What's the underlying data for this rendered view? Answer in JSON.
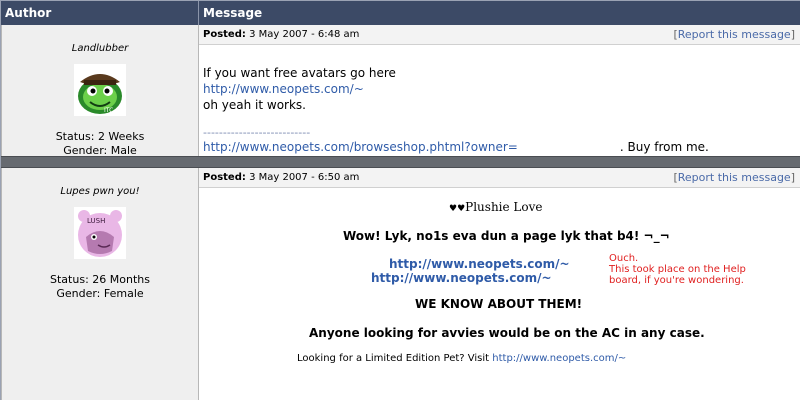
{
  "header": {
    "author_label": "Author",
    "message_label": "Message"
  },
  "posts": [
    {
      "author": "Landlubber",
      "avatar_icon": "pirate-frog-avatar-icon",
      "status": "Status: 2 Weeks",
      "gender": "Gender: Male",
      "posted_label": "Posted:",
      "posted_date": "3 May 2007 - 6:48 am",
      "report_label": "Report this message",
      "lines": [
        "If you want free avatars go here",
        "http://www.neopets.com/~",
        "oh yeah it works."
      ],
      "sig_separator": "---------------------------",
      "shop_link": "http://www.neopets.com/browseshop.phtml?owner=",
      "shop_suffix": ". Buy from me."
    },
    {
      "author": "Lupes pwn you!",
      "avatar_icon": "plushie-lupe-avatar-icon",
      "status": "Status: 26 Months",
      "gender": "Gender: Female",
      "posted_label": "Posted:",
      "posted_date": "3 May 2007 - 6:50 am",
      "report_label": "Report this message",
      "hearts": "♥♥",
      "plushie_title": "Plushie Love",
      "wow": "Wow! Lyk, no1s eva dun a page lyk that b4! ¬_¬",
      "url_a": "http://www.neopets.com/~",
      "url_b": "http://www.neopets.com/~",
      "ouch": "Ouch.",
      "ouch_note": "This took place on the Help board, if you're wondering.",
      "know": "WE KNOW ABOUT THEM!",
      "anyone": "Anyone looking for avvies would be on the AC in any case.",
      "limited_text": "Looking for a Limited Edition Pet? Visit",
      "limited_link": "http://www.neopets.com/~"
    }
  ],
  "colors": {
    "header_bg": "#3c4a66",
    "link": "#2f5ba8",
    "note_red": "#e02020"
  }
}
